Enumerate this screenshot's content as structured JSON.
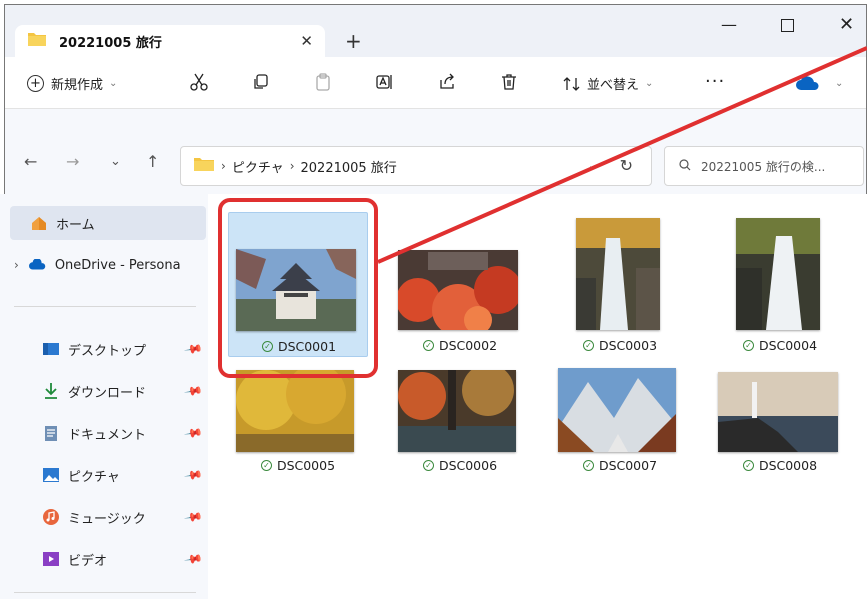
{
  "window": {
    "tab_title": "20221005 旅行",
    "tab_close": "✕",
    "new_tab": "+",
    "minimize": "—",
    "close": "✕"
  },
  "toolbar": {
    "new_label": "新規作成",
    "sort_label": "並べ替え",
    "more": "···",
    "icons": [
      "cut-icon",
      "copy-icon",
      "paste-icon",
      "rename-icon",
      "share-icon",
      "delete-icon"
    ]
  },
  "address": {
    "segments": [
      "ピクチャ",
      "20221005 旅行"
    ],
    "separator": "›",
    "search_placeholder": "20221005 旅行の検..."
  },
  "nav": {
    "back": "←",
    "forward": "→",
    "recent": "⌄",
    "up": "↑"
  },
  "sidebar": {
    "home": "ホーム",
    "onedrive": "OneDrive - Persona",
    "quick_access": [
      {
        "label": "デスクトップ",
        "icon": "desktop-icon"
      },
      {
        "label": "ダウンロード",
        "icon": "download-icon"
      },
      {
        "label": "ドキュメント",
        "icon": "documents-icon"
      },
      {
        "label": "ピクチャ",
        "icon": "pictures-icon"
      },
      {
        "label": "ミュージック",
        "icon": "music-icon"
      },
      {
        "label": "ビデオ",
        "icon": "videos-icon"
      }
    ]
  },
  "files": [
    {
      "name": "DSC0001",
      "selected": true
    },
    {
      "name": "DSC0002"
    },
    {
      "name": "DSC0003"
    },
    {
      "name": "DSC0004"
    },
    {
      "name": "DSC0005"
    },
    {
      "name": "DSC0006"
    },
    {
      "name": "DSC0007"
    },
    {
      "name": "DSC0008"
    }
  ],
  "colors": {
    "accent": "#0067c0",
    "selection": "#cce4f7",
    "annotation": "#e03030",
    "sync_ok": "#3b8a3e"
  }
}
